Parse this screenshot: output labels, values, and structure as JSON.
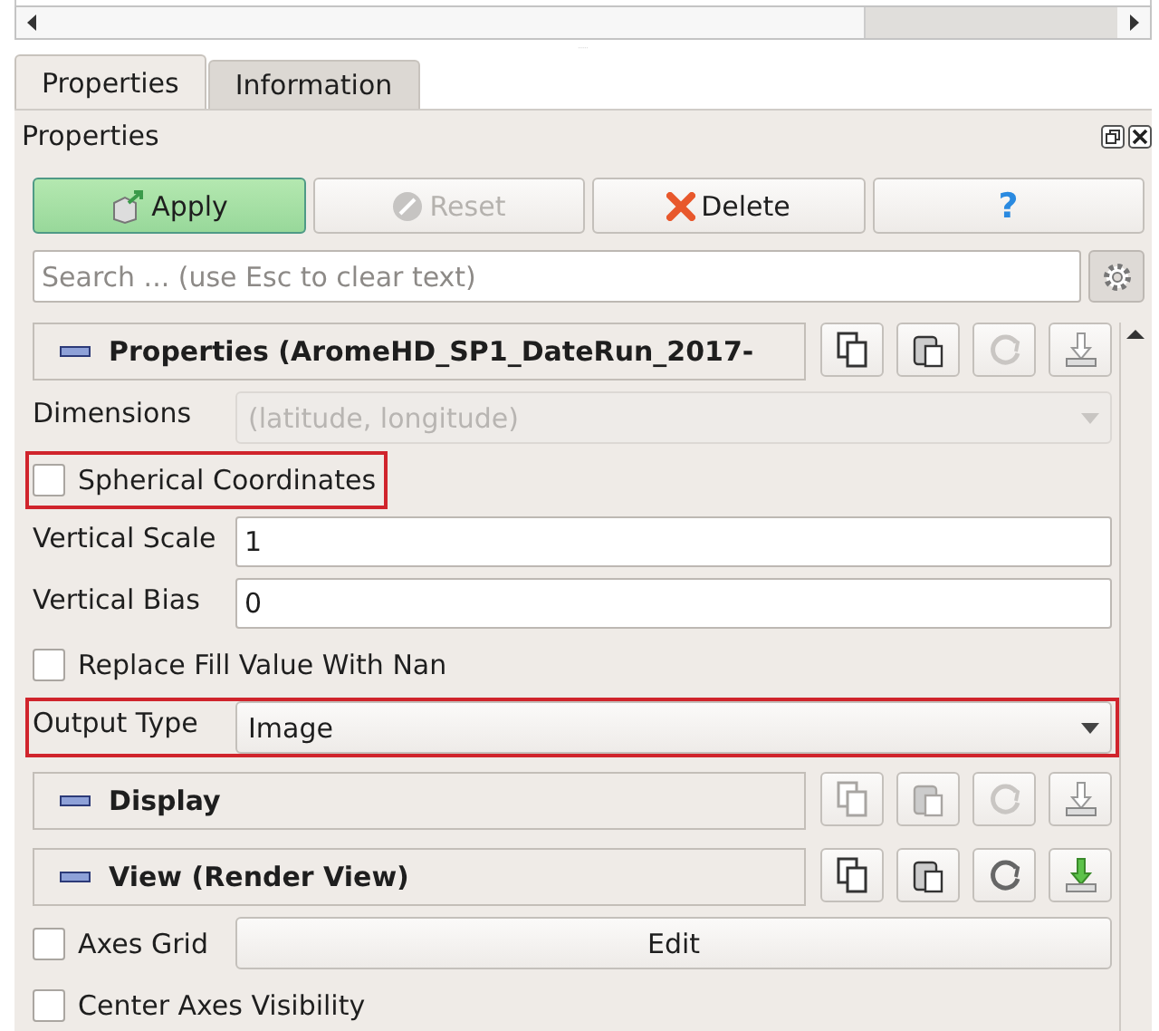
{
  "tabs": [
    {
      "label": "Properties",
      "selected": true
    },
    {
      "label": "Information",
      "selected": false
    }
  ],
  "panel": {
    "title": "Properties"
  },
  "buttons": [
    {
      "kind": "apply",
      "label": "Apply",
      "disabled": false
    },
    {
      "kind": "reset",
      "label": "Reset",
      "disabled": true
    },
    {
      "kind": "delete",
      "label": "Delete",
      "disabled": false
    },
    {
      "kind": "help",
      "label": "?",
      "disabled": false
    }
  ],
  "search": {
    "placeholder": "Search ... (use Esc to clear text)"
  },
  "sections": [
    {
      "title": "Properties (AromeHD_SP1_DateRun_2017-",
      "tools": [
        {
          "kind": "copy",
          "disabled": false
        },
        {
          "kind": "paste",
          "disabled": false
        },
        {
          "kind": "reset",
          "disabled": true
        },
        {
          "kind": "save",
          "disabled": true
        }
      ],
      "rows": [
        {
          "kind": "combo",
          "label": "Dimensions",
          "value": "(latitude, longitude)",
          "disabled": true,
          "highlighted": false
        },
        {
          "kind": "checkbox",
          "label": "Spherical Coordinates",
          "checked": false,
          "highlighted": true
        },
        {
          "kind": "text",
          "label": "Vertical Scale",
          "value": "1",
          "highlighted": false
        },
        {
          "kind": "text",
          "label": "Vertical Bias",
          "value": "0",
          "highlighted": false
        },
        {
          "kind": "checkbox",
          "label": "Replace Fill Value With Nan",
          "checked": false,
          "highlighted": false
        },
        {
          "kind": "combo",
          "label": "Output Type",
          "value": "Image",
          "disabled": false,
          "highlighted": true
        }
      ]
    },
    {
      "title": "Display",
      "tools": [
        {
          "kind": "copy",
          "disabled": true
        },
        {
          "kind": "paste",
          "disabled": true
        },
        {
          "kind": "reset",
          "disabled": true
        },
        {
          "kind": "save",
          "disabled": true
        }
      ]
    },
    {
      "title": "View (Render View)",
      "tools": [
        {
          "kind": "copy",
          "disabled": false
        },
        {
          "kind": "paste",
          "disabled": false
        },
        {
          "kind": "reset",
          "disabled": false
        },
        {
          "kind": "save",
          "disabled": false
        }
      ],
      "rows": [
        {
          "kind": "checkbox-button",
          "label": "Axes Grid",
          "checked": false,
          "button": "Edit",
          "highlighted": false
        },
        {
          "kind": "checkbox",
          "label": "Center Axes Visibility",
          "checked": false,
          "highlighted": false
        }
      ]
    }
  ]
}
